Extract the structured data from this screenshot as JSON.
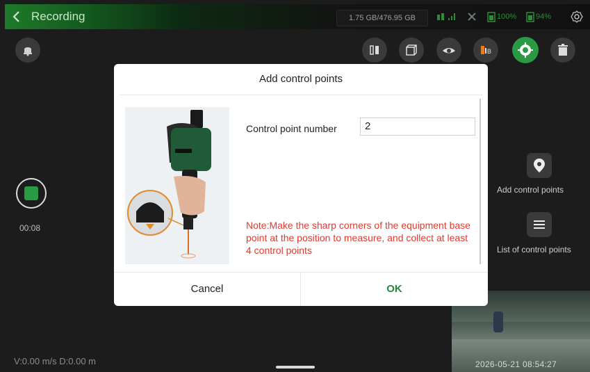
{
  "header": {
    "title": "Recording",
    "storage": "1.75 GB/476.95 GB",
    "battery1": "100%",
    "battery2": "94%",
    "icons": [
      "back-chevron-icon",
      "signal-icon",
      "satellite-icon",
      "battery-icon",
      "battery-icon",
      "settings-gear-icon"
    ]
  },
  "toolbar": {
    "icons": [
      "alarm-bell-icon",
      "layer-icon",
      "cube-icon",
      "eye-icon",
      "color-palette-icon",
      "control-point-target-icon",
      "trash-icon"
    ]
  },
  "left": {
    "timer": "00:08",
    "speed": "V:0.00 m/s  D:0.00 m"
  },
  "right_panel": {
    "add_label": "Add control points",
    "list_label": "List of control points"
  },
  "dialog": {
    "title": "Add control points",
    "field_label": "Control point number",
    "field_value": "2",
    "note": "Note:Make the sharp corners of the equipment base point at the position to measure, and collect at least 4 control points",
    "cancel": "Cancel",
    "ok": "OK"
  },
  "preview": {
    "timestamp": "2026-05-21 08:54:27"
  },
  "colors": {
    "accent_green": "#2b9a45",
    "note_red": "#e2392e",
    "ok_green": "#22883a"
  }
}
